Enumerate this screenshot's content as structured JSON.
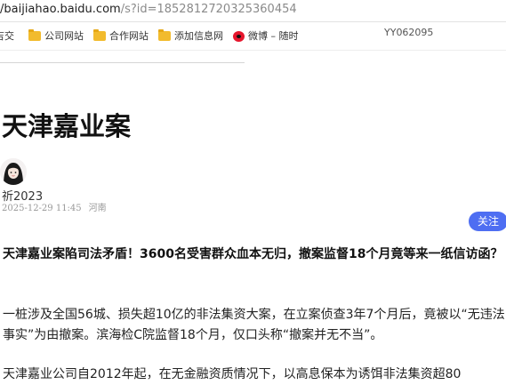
{
  "browser": {
    "url_host": "/baijiahao.baidu.com",
    "url_path": "/s?id=1852812720325360454",
    "bookmarks": [
      {
        "icon": "folder-icon",
        "label": "吉交"
      },
      {
        "icon": "folder-icon",
        "label": "公司网站"
      },
      {
        "icon": "folder-icon",
        "label": "合作网站"
      },
      {
        "icon": "folder-icon",
        "label": "添加信息网"
      },
      {
        "icon": "weibo-icon",
        "label": "微博 – 随时"
      }
    ],
    "overlay_id": "YY062095"
  },
  "article": {
    "title": "天津嘉业案",
    "author": "祈2023",
    "date": "2025-12-29 11:45",
    "location": "河南",
    "follow_label": "关注",
    "lead": "天津嘉业案陷司法矛盾！3600名受害群众血本无归，撤案监督18个月竟等来一纸信访函？",
    "paragraphs": [
      "一桩涉及全国56城、损失超10亿的非法集资大案，在立案侦查3年7个月后，竟被以“无违法事实”为由撤案。滨海检C院监督18个月，仅口头称“撤案并无不当”。",
      "天津嘉业公司自2012年起，在无金融资质情况下，以高息保本为诱饵非法集资超80"
    ]
  }
}
